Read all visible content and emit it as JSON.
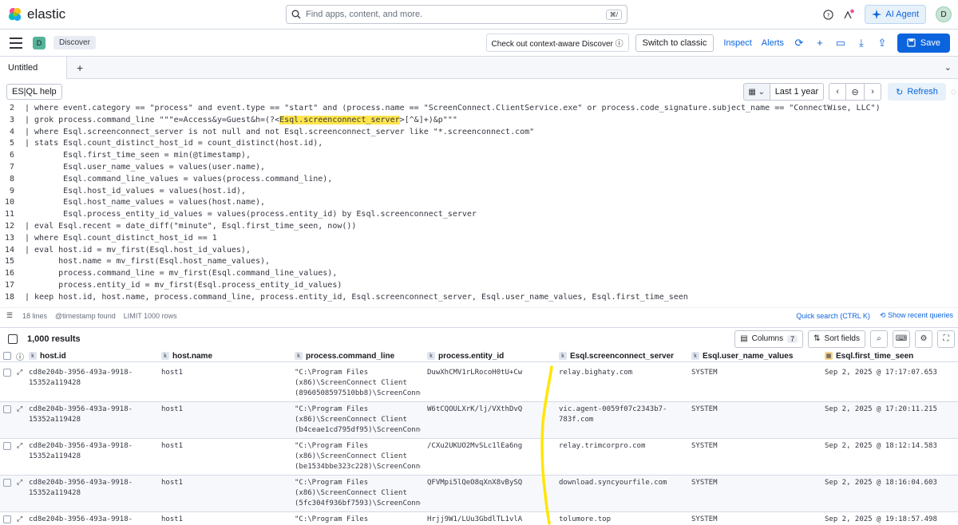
{
  "header": {
    "logo_text": "elastic",
    "search_placeholder": "Find apps, content, and more.",
    "search_shortcut": "⌘/",
    "ai_agent_label": "AI Agent",
    "user_avatar": "D"
  },
  "appbar": {
    "space_avatar": "D",
    "breadcrumb": "Discover",
    "context_label": "Check out context-aware Discover",
    "switch_label": "Switch to classic",
    "inspect_label": "Inspect",
    "alerts_label": "Alerts",
    "save_label": "Save"
  },
  "tabs": {
    "active": "Untitled",
    "add": "+",
    "menu": "⌄"
  },
  "esql_toolbar": {
    "help_label": "ES|QL help",
    "date_range": "Last 1 year",
    "refresh_label": "Refresh"
  },
  "editor": {
    "lines": [
      {
        "n": "2",
        "text": "| where event.category == \"process\" and event.type == \"start\" and (process.name == \"ScreenConnect.ClientService.exe\" or process.code_signature.subject_name == \"ConnectWise, LLC\")"
      },
      {
        "n": "3",
        "text_pre": "| grok process.command_line \"\"\"e=Access&y=Guest&h=(?<",
        "text_hl": "Esql.screenconnect_server",
        "text_post": ">[^&]+)&p\"\"\""
      },
      {
        "n": "4",
        "text": "| where Esql.screenconnect_server is not null and not Esql.screenconnect_server like \"*.screenconnect.com\""
      },
      {
        "n": "5",
        "text": "| stats Esql.count_distinct_host_id = count_distinct(host.id),"
      },
      {
        "n": "6",
        "text": "        Esql.first_time_seen = min(@timestamp),"
      },
      {
        "n": "7",
        "text": "        Esql.user_name_values = values(user.name),"
      },
      {
        "n": "8",
        "text": "        Esql.command_line_values = values(process.command_line),"
      },
      {
        "n": "9",
        "text": "        Esql.host_id_values = values(host.id),"
      },
      {
        "n": "10",
        "text": "        Esql.host_name_values = values(host.name),"
      },
      {
        "n": "11",
        "text": "        Esql.process_entity_id_values = values(process.entity_id) by Esql.screenconnect_server"
      },
      {
        "n": "12",
        "text": "| eval Esql.recent = date_diff(\"minute\", Esql.first_time_seen, now())"
      },
      {
        "n": "13",
        "text": "| where Esql.count_distinct_host_id == 1"
      },
      {
        "n": "14",
        "text": "| eval host.id = mv_first(Esql.host_id_values),"
      },
      {
        "n": "15",
        "text": "       host.name = mv_first(Esql.host_name_values),"
      },
      {
        "n": "16",
        "text": "       process.command_line = mv_first(Esql.command_line_values),"
      },
      {
        "n": "17",
        "text": "       process.entity_id = mv_first(Esql.process_entity_id_values)"
      },
      {
        "n": "18",
        "text": "| keep host.id, host.name, process.command_line, process.entity_id, Esql.screenconnect_server, Esql.user_name_values, Esql.first_time_seen"
      }
    ],
    "footer_lines": "18 lines",
    "footer_timestamp": "@timestamp found",
    "footer_limit": "LIMIT 1000 rows",
    "quick_search": "Quick search (CTRL K)",
    "recent_queries": "Show recent queries"
  },
  "results": {
    "count_label": "1,000 results",
    "columns_label": "Columns",
    "columns_count": "7",
    "sort_label": "Sort fields",
    "headers": [
      "host.id",
      "host.name",
      "process.command_line",
      "process.entity_id",
      "Esql.screenconnect_server",
      "Esql.user_name_values",
      "Esql.first_time_seen"
    ],
    "rows": [
      {
        "host_id": "cd8e204b-3956-493a-9918-\n15352a119428",
        "host_name": "host1",
        "cmd": "\"C:\\Program Files\n(x86)\\ScreenConnect Client\n(8960508597510bb8)\\ScreenConne…",
        "entity": "DuwXhCMV1rLRocoH0tU+Cw",
        "server": "relay.bighaty.com",
        "user": "SYSTEM",
        "time": "Sep 2, 2025 @ 17:17:07.653"
      },
      {
        "host_id": "cd8e204b-3956-493a-9918-\n15352a119428",
        "host_name": "host1",
        "cmd": "\"C:\\Program Files\n(x86)\\ScreenConnect Client\n(b4ceae1cd795df95)\\ScreenConne…",
        "entity": "W6tCQOULXrK/lj/VXthDvQ",
        "server": "vic.agent-0059f07c2343b7-\n783f.com",
        "user": "SYSTEM",
        "time": "Sep 2, 2025 @ 17:20:11.215"
      },
      {
        "host_id": "cd8e204b-3956-493a-9918-\n15352a119428",
        "host_name": "host1",
        "cmd": "\"C:\\Program Files\n(x86)\\ScreenConnect Client\n(be1534bbe323c228)\\ScreenConne…",
        "entity": "/CXu2UKUO2MvSLc1lEa6ng",
        "server": "relay.trimcorpro.com",
        "user": "SYSTEM",
        "time": "Sep 2, 2025 @ 18:12:14.583"
      },
      {
        "host_id": "cd8e204b-3956-493a-9918-\n15352a119428",
        "host_name": "host1",
        "cmd": "\"C:\\Program Files\n(x86)\\ScreenConnect Client\n(5fc304f936bf7593)\\ScreenConne…",
        "entity": "QFVMpi5lQeO8qXnX8vBySQ",
        "server": "download.syncyourfile.com",
        "user": "SYSTEM",
        "time": "Sep 2, 2025 @ 18:16:04.603"
      },
      {
        "host_id": "cd8e204b-3956-493a-9918-",
        "host_name": "host1",
        "cmd": "\"C:\\Program Files",
        "entity": "Hrjj9W1/LUu3GbdlTL1vlA",
        "server": "tolumore.top",
        "user": "SYSTEM",
        "time": "Sep 2, 2025 @ 19:18:57.498"
      }
    ]
  },
  "colors": {
    "accent": "#0b64dd",
    "highlight": "#ffe54c",
    "annotation": "#ffe600"
  }
}
